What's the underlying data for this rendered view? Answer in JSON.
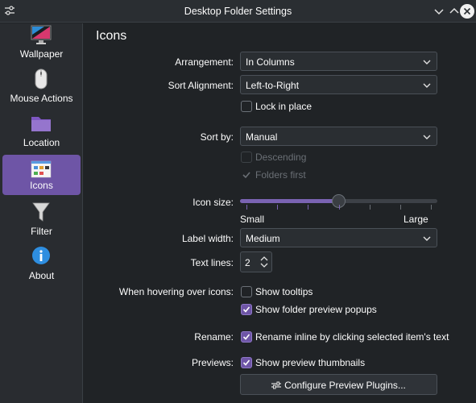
{
  "window": {
    "title": "Desktop Folder Settings"
  },
  "sidebar": {
    "items": [
      {
        "label": "Wallpaper",
        "icon": "monitor-icon"
      },
      {
        "label": "Mouse Actions",
        "icon": "mouse-icon"
      },
      {
        "label": "Location",
        "icon": "folder-icon"
      },
      {
        "label": "Icons",
        "icon": "icons-view-icon",
        "active": true
      },
      {
        "label": "Filter",
        "icon": "funnel-icon"
      },
      {
        "label": "About",
        "icon": "info-icon"
      }
    ]
  },
  "page": {
    "title": "Icons"
  },
  "arrangement": {
    "label": "Arrangement:",
    "value": "In Columns"
  },
  "sort_alignment": {
    "label": "Sort Alignment:",
    "value": "Left-to-Right"
  },
  "lock_in_place": {
    "label": "Lock in place",
    "checked": false
  },
  "sort_by": {
    "label": "Sort by:",
    "value": "Manual"
  },
  "descending": {
    "label": "Descending",
    "checked": false,
    "enabled": false
  },
  "folders_first": {
    "label": "Folders first",
    "checked": true,
    "enabled": false
  },
  "icon_size": {
    "label": "Icon size:",
    "min_label": "Small",
    "max_label": "Large",
    "value_fraction": 0.5
  },
  "label_width": {
    "label": "Label width:",
    "value": "Medium"
  },
  "text_lines": {
    "label": "Text lines:",
    "value": "2"
  },
  "hover": {
    "label": "When hovering over icons:",
    "show_tooltips": {
      "label": "Show tooltips",
      "checked": false
    },
    "show_folder_preview": {
      "label": "Show folder preview popups",
      "checked": true
    }
  },
  "rename": {
    "label": "Rename:",
    "option": {
      "label": "Rename inline by clicking selected item's text",
      "checked": true
    }
  },
  "previews": {
    "label": "Previews:",
    "option": {
      "label": "Show preview thumbnails",
      "checked": true
    },
    "configure_button": "Configure Preview Plugins..."
  },
  "colors": {
    "accent": "#6e55a6",
    "background": "#202326",
    "sidebar": "#292c30"
  }
}
